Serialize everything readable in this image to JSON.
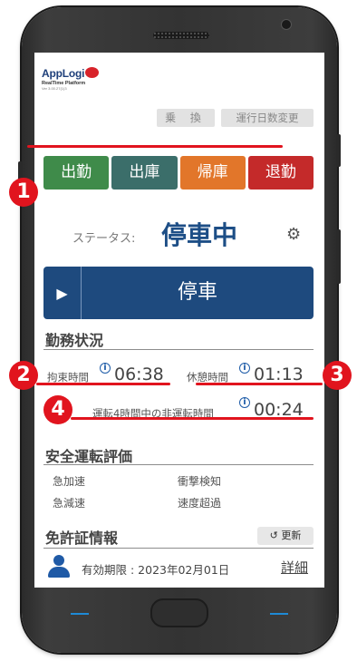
{
  "logo": {
    "name": "AppLogi",
    "subtitle": "RealTime Platform",
    "version": "Ver 3.00.27(1)3"
  },
  "top_buttons": {
    "transfer": "乗 換",
    "change_days": "運行日数変更"
  },
  "actions": [
    {
      "label": "出勤",
      "color": "#3f8b4a"
    },
    {
      "label": "出庫",
      "color": "#3b6e6a"
    },
    {
      "label": "帰庫",
      "color": "#e2762a"
    },
    {
      "label": "退勤",
      "color": "#c42a2a"
    }
  ],
  "status": {
    "label": "ステータス:",
    "value": "停車中"
  },
  "stop_bar": {
    "label": "停車"
  },
  "work_status": {
    "title": "勤務状況",
    "restraint_label": "拘束時間",
    "restraint_value": "06:38",
    "rest_label": "休憩時間",
    "rest_value": "01:13",
    "non_driving_label": "運転4時間中の非運転時間",
    "non_driving_value": "00:24"
  },
  "safety_eval": {
    "title": "安全運転評価",
    "items": [
      "急加速",
      "衝撃検知",
      "急減速",
      "速度超過"
    ]
  },
  "license": {
    "title": "免許証情報",
    "refresh_label": "↺ 更新",
    "expiry": "有効期限 : 2023年02月01日",
    "detail_label": "詳細"
  },
  "markers": [
    "1",
    "2",
    "3",
    "4"
  ],
  "colors": {
    "accent_blue": "#1d4e86",
    "marker_red": "#e1141e"
  }
}
